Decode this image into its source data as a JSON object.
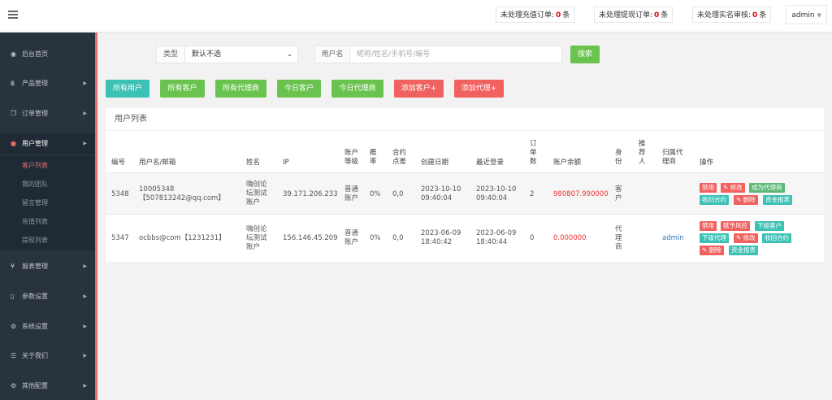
{
  "header": {
    "notices": [
      {
        "label": "未处理充值订单:",
        "count": "0",
        "unit": "条"
      },
      {
        "label": "未处理提现订单:",
        "count": "0",
        "unit": "条"
      },
      {
        "label": "未处理实名审核:",
        "count": "0",
        "unit": "条"
      }
    ],
    "user": "admin"
  },
  "sidebar": {
    "items": [
      {
        "label": "后台首页",
        "icon": "dashboard-icon"
      },
      {
        "label": "产品管理",
        "icon": "bitcoin-icon"
      },
      {
        "label": "订单管理",
        "icon": "copy-icon"
      },
      {
        "label": "用户管理",
        "icon": "user-icon"
      },
      {
        "label": "报表管理",
        "icon": "yen-icon"
      },
      {
        "label": "参数设置",
        "icon": "file-icon"
      },
      {
        "label": "系统设置",
        "icon": "gears-icon"
      },
      {
        "label": "关于我们",
        "icon": "list-icon"
      },
      {
        "label": "其他配置",
        "icon": "gear-icon"
      }
    ],
    "subitems": [
      "客户列表",
      "我的团队",
      "留言管理",
      "充值列表",
      "提现列表"
    ]
  },
  "search": {
    "type_label": "类型",
    "type_value": "默认不选",
    "user_label": "用户名",
    "user_placeholder": "昵称/姓名/手机号/编号",
    "search_button": "搜索"
  },
  "filters": [
    "所有用户",
    "所有客户",
    "所有代理商",
    "今日客户",
    "今日代理商"
  ],
  "actions": [
    "添加客户+",
    "添加代理+"
  ],
  "table": {
    "title": "用户列表",
    "columns": {
      "id": "编号",
      "username": "用户名/邮箱",
      "name": "姓名",
      "ip": "IP",
      "level": [
        "账户",
        "等级"
      ],
      "rate": [
        "概",
        "率"
      ],
      "spread": [
        "合约",
        "点差"
      ],
      "created": "创建日期",
      "last_login": "最近登录",
      "orders": [
        "订",
        "单",
        "数"
      ],
      "balance": "账户余额",
      "role": [
        "身",
        "份"
      ],
      "referrer": [
        "推",
        "荐",
        "人"
      ],
      "agent": [
        "归属代",
        "理商"
      ],
      "ops": "操作"
    },
    "rows": [
      {
        "id": "5348",
        "username": [
          "10005348",
          "【507813242@qq.com】"
        ],
        "name": [
          "嗨创论",
          "坛测试",
          "账户"
        ],
        "ip": "39.171.206.233",
        "level": [
          "普通",
          "账户"
        ],
        "rate": "0%",
        "spread": "0,0",
        "created": [
          "2023-10-10",
          "09:40:04"
        ],
        "last_login": [
          "2023-10-10",
          "09:40:04"
        ],
        "orders": "2",
        "balance": "980807.990000",
        "role": [
          "客",
          "户"
        ],
        "agent": "",
        "ops": [
          "禁用",
          "✎ 修改",
          "成为代理商",
          "收回合约",
          "✎ 删除",
          "资金报表"
        ]
      },
      {
        "id": "5347",
        "username": [
          "ocbbs@com【1231231】"
        ],
        "name": [
          "嗨创论",
          "坛测试",
          "账户"
        ],
        "ip": "156.146.45.209",
        "level": [
          "普通",
          "账户"
        ],
        "rate": "0%",
        "spread": "0,0",
        "created": [
          "2023-06-09",
          "18:40:42"
        ],
        "last_login": [
          "2023-06-09",
          "18:40:44"
        ],
        "orders": "0",
        "balance": "0.000000",
        "role": [
          "代",
          "理",
          "商"
        ],
        "agent": "admin",
        "ops": [
          "禁用",
          "赋予风控",
          "下级客户",
          "下级代理",
          "✎ 修改",
          "收回合约",
          "✎ 删除",
          "资金报表"
        ]
      }
    ]
  }
}
